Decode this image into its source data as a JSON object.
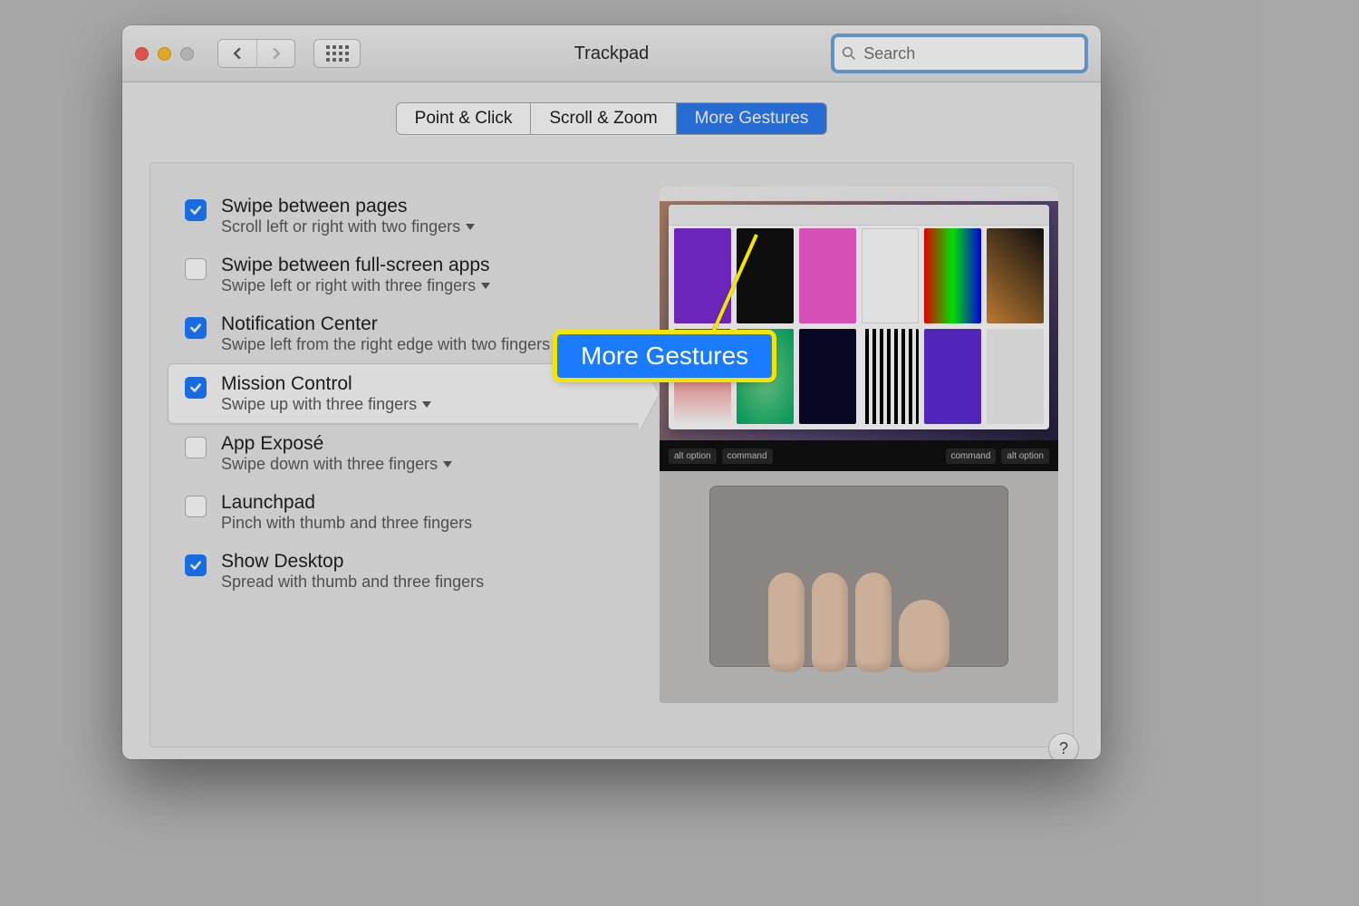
{
  "window": {
    "title": "Trackpad"
  },
  "search": {
    "placeholder": "Search"
  },
  "tabs": {
    "point_click": "Point & Click",
    "scroll_zoom": "Scroll & Zoom",
    "more_gestures": "More Gestures"
  },
  "callout": {
    "label": "More Gestures"
  },
  "touchbar": {
    "left": [
      "alt option",
      "command"
    ],
    "right": [
      "command",
      "alt option"
    ]
  },
  "options": [
    {
      "title": "Swipe between pages",
      "sub": "Scroll left or right with two fingers",
      "checked": true,
      "dropdown": true,
      "selected": false
    },
    {
      "title": "Swipe between full-screen apps",
      "sub": "Swipe left or right with three fingers",
      "checked": false,
      "dropdown": true,
      "selected": false
    },
    {
      "title": "Notification Center",
      "sub": "Swipe left from the right edge with two fingers",
      "checked": true,
      "dropdown": false,
      "selected": false
    },
    {
      "title": "Mission Control",
      "sub": "Swipe up with three fingers",
      "checked": true,
      "dropdown": true,
      "selected": true
    },
    {
      "title": "App Exposé",
      "sub": "Swipe down with three fingers",
      "checked": false,
      "dropdown": true,
      "selected": false
    },
    {
      "title": "Launchpad",
      "sub": "Pinch with thumb and three fingers",
      "checked": false,
      "dropdown": false,
      "selected": false
    },
    {
      "title": "Show Desktop",
      "sub": "Spread with thumb and three fingers",
      "checked": true,
      "dropdown": false,
      "selected": false
    }
  ],
  "help": "?"
}
